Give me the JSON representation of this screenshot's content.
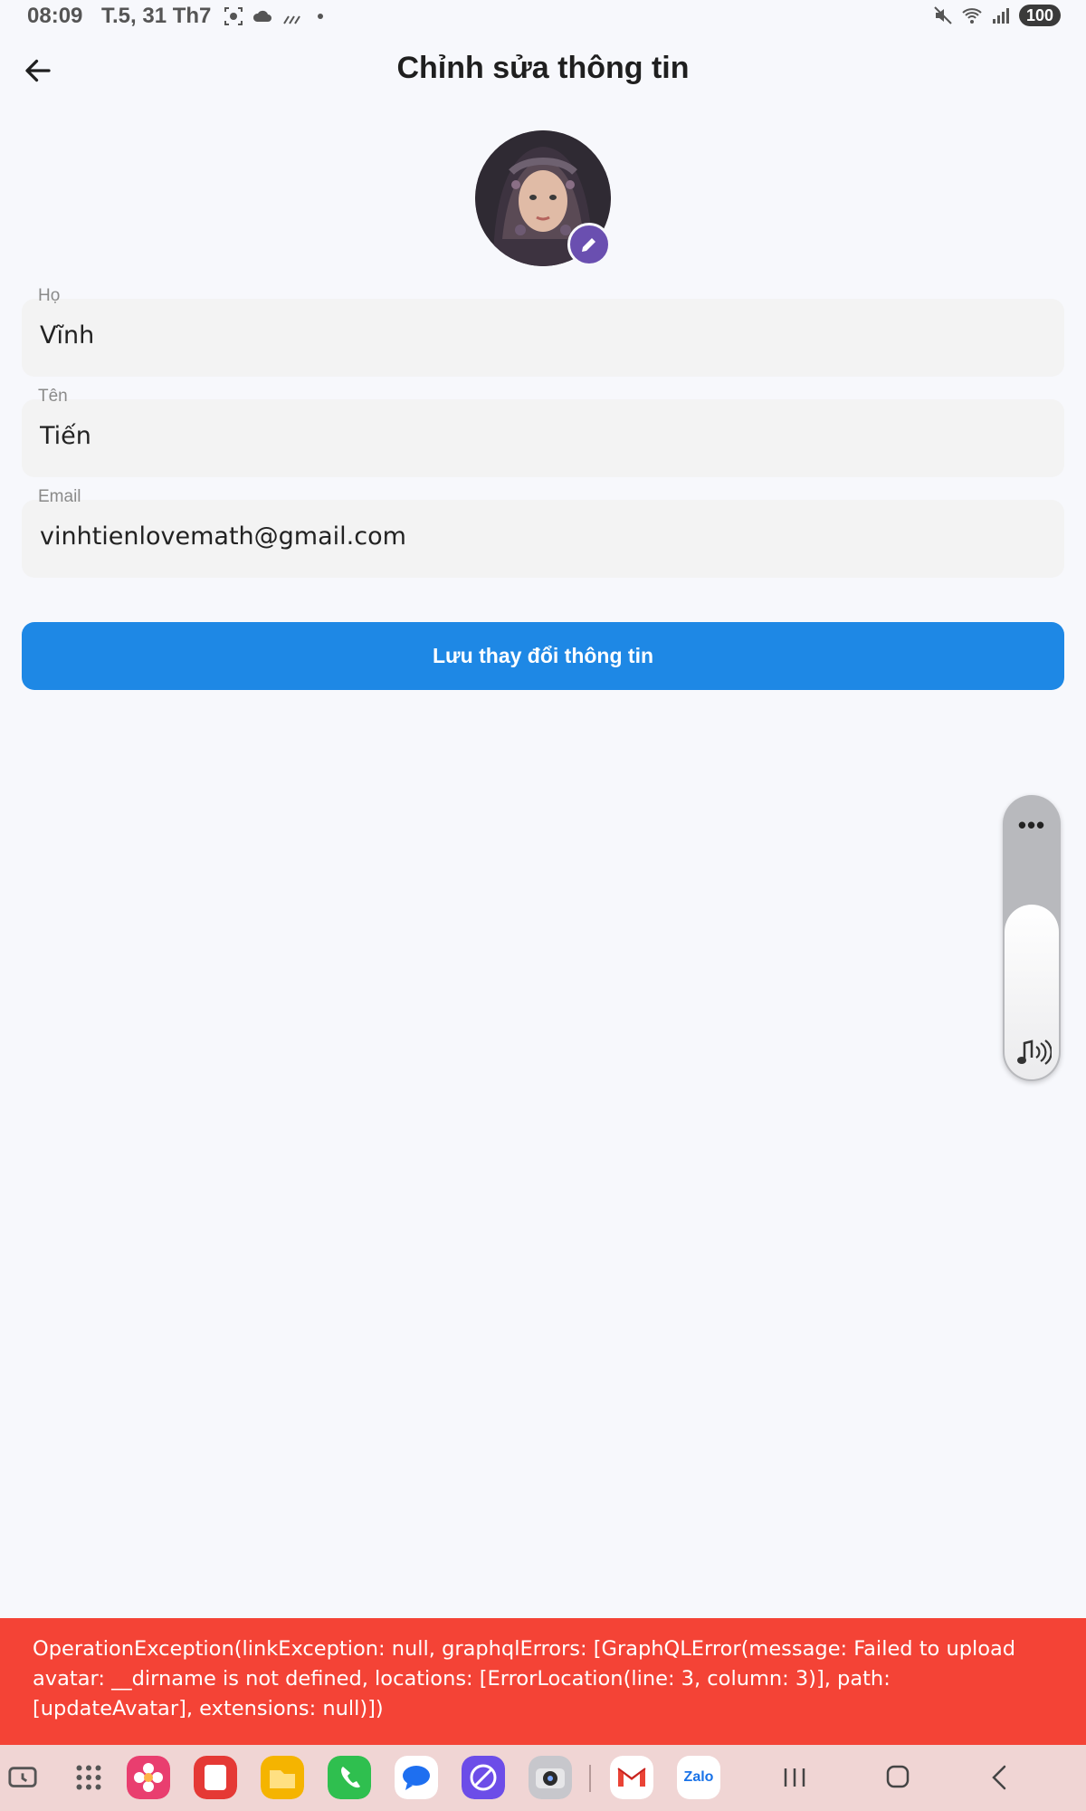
{
  "status_bar": {
    "time": "08:09",
    "date": "T.5, 31 Th7",
    "battery": "100"
  },
  "header": {
    "title": "Chỉnh sửa thông tin"
  },
  "form": {
    "last_name": {
      "label": "Họ",
      "value": "Vĩnh"
    },
    "first_name": {
      "label": "Tên",
      "value": "Tiến"
    },
    "email": {
      "label": "Email",
      "value": "vinhtienlovemath@gmail.com"
    }
  },
  "save_button": {
    "label": "Lưu thay đổi thông tin"
  },
  "volume": {
    "more_label": "•••",
    "level": 0.62
  },
  "error_message": "OperationException(linkException: null, graphqlErrors: [GraphQLError(message: Failed to upload avatar: __dirname is not defined, locations: [ErrorLocation(line: 3, column: 3)], path: [updateAvatar], extensions: null)])",
  "dock": {
    "apps": [
      "recent-apps-icon",
      "app-drawer-icon",
      "gallery-icon",
      "notes-icon",
      "files-icon",
      "phone-icon",
      "messages-icon",
      "browser-icon",
      "camera-icon",
      "gmail-icon",
      "zalo-icon"
    ],
    "zalo_label": "Zalo"
  },
  "colors": {
    "primary_button": "#1e88e5",
    "edit_badge": "#6a4fb0",
    "error": "#f44336"
  }
}
